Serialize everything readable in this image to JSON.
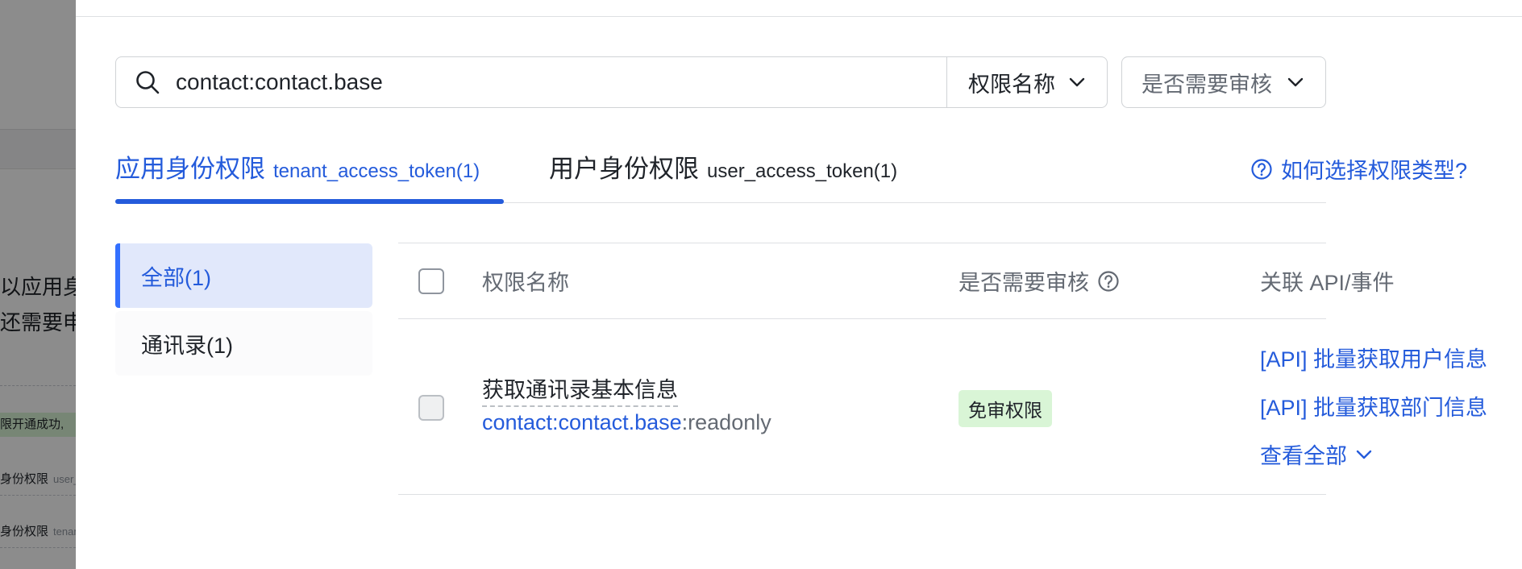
{
  "background_page": {
    "text_line_1": "以应用身",
    "text_line_2": "还需要申",
    "notice": "限开通成功,",
    "rows": [
      {
        "title": "身份权限",
        "sub": "user_"
      },
      {
        "title": "身份权限",
        "sub": "tenan"
      }
    ]
  },
  "search": {
    "value": "contact:contact.base",
    "field_select": "权限名称",
    "review_select_placeholder": "是否需要审核"
  },
  "tabs": [
    {
      "title": "应用身份权限",
      "sub": "tenant_access_token(1)",
      "active": true
    },
    {
      "title": "用户身份权限",
      "sub": "user_access_token(1)",
      "active": false
    }
  ],
  "help_link": "如何选择权限类型?",
  "categories": [
    {
      "label": "全部(1)",
      "active": true
    },
    {
      "label": "通讯录(1)",
      "active": false
    }
  ],
  "table": {
    "headers": {
      "name": "权限名称",
      "review": "是否需要审核",
      "related": "关联 API/事件"
    },
    "rows": [
      {
        "name": "获取通讯录基本信息",
        "code_highlight": "contact:contact.base",
        "code_rest": ":readonly",
        "review_badge": "免审权限",
        "apis": [
          "[API] 批量获取用户信息",
          "[API] 批量获取部门信息"
        ],
        "view_all": "查看全部"
      }
    ]
  },
  "colors": {
    "accent": "#245bdb",
    "badge_bg": "#d9f5d6",
    "active_category_bg": "#e1e8fb"
  }
}
